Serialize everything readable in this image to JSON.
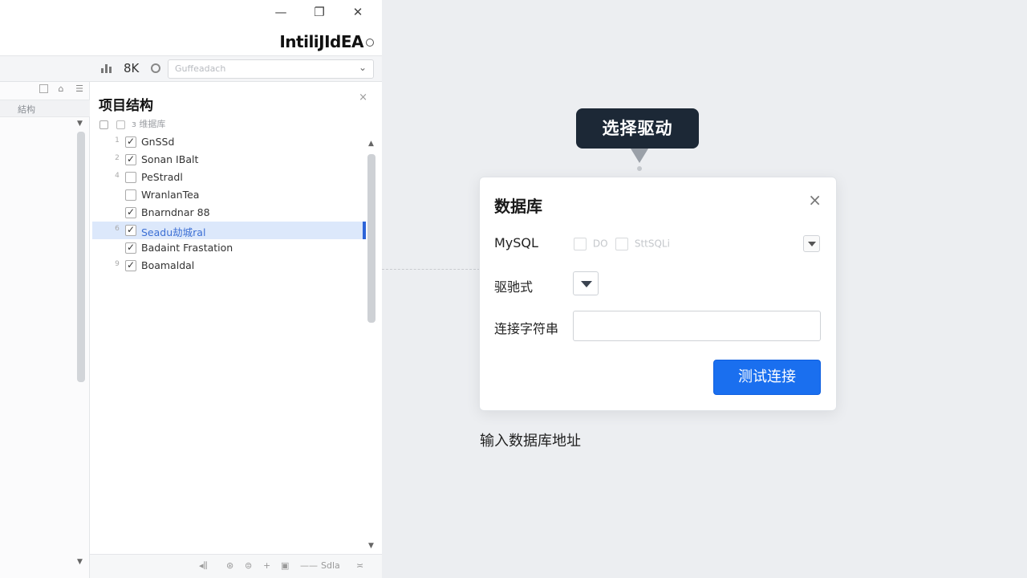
{
  "window": {
    "minimize": "—",
    "maximize": "❐",
    "close": "✕"
  },
  "brand": {
    "name": "IntiliJIdEA"
  },
  "toolbar": {
    "count": "8K",
    "branch_value": "Guffeadach"
  },
  "left_strip": {
    "column_header": "結构"
  },
  "project_panel": {
    "title": "项目结构",
    "close": "×",
    "root_label": "з 维据库",
    "items": [
      {
        "num": "1",
        "label": "GnSSd",
        "checked": true,
        "selected": false
      },
      {
        "num": "2",
        "label": "Sonan IBalt",
        "checked": true,
        "selected": false
      },
      {
        "num": "4",
        "label": "PeStradl",
        "checked": false,
        "selected": false
      },
      {
        "num": "",
        "label": "WranlanTea",
        "checked": false,
        "selected": false
      },
      {
        "num": "",
        "label": "Bnarndnar 88",
        "checked": true,
        "selected": false
      },
      {
        "num": "6",
        "label": "Seadu劫城ral",
        "checked": true,
        "selected": true
      },
      {
        "num": "",
        "label": "Badaint Frastation",
        "checked": true,
        "selected": false
      },
      {
        "num": "9",
        "label": "Boamaldal",
        "checked": true,
        "selected": false
      }
    ],
    "bottom_bar_text": "Sdla"
  },
  "callout": {
    "text": "选择驱动"
  },
  "dialog": {
    "title": "数据库",
    "close": "×",
    "db_type_label": "MySQL",
    "db_options": [
      "DO",
      "SttSQLi"
    ],
    "driver_label": "驱驰式",
    "connection_label": "连接字符串",
    "connection_value": "",
    "test_button": "测试连接"
  },
  "hint": {
    "text": "输入数据库地址"
  },
  "colors": {
    "primary_button": "#1a6fef",
    "callout_bg": "#1c2836",
    "selection_bg": "#dce8fb",
    "selection_marker": "#2d64d8"
  }
}
